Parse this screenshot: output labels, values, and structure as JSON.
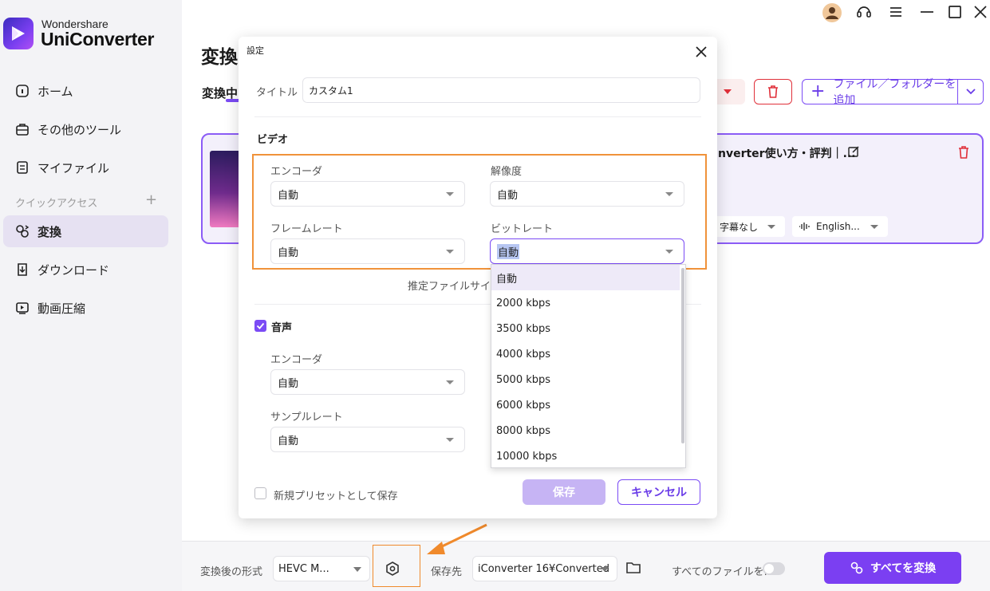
{
  "app": {
    "brand_small": "Wondershare",
    "brand_name": "UniConverter"
  },
  "sidebar": {
    "items": [
      {
        "label": "ホーム",
        "icon": "home-icon"
      },
      {
        "label": "その他のツール",
        "icon": "toolbox-icon"
      },
      {
        "label": "マイファイル",
        "icon": "file-icon"
      }
    ],
    "quick_access_label": "クイックアクセス",
    "quick_items": [
      {
        "label": "変換",
        "icon": "convert-icon",
        "active": true
      },
      {
        "label": "ダウンロード",
        "icon": "download-icon"
      },
      {
        "label": "動画圧縮",
        "icon": "compress-icon"
      }
    ]
  },
  "main": {
    "title": "変換",
    "tab_converting": "変換中",
    "add_files_label": "ファイル／フォルダーを追加",
    "file_name": "nverter使い方・評判｜...",
    "subtitle_select": "字幕なし",
    "audio_select": "English..."
  },
  "dialog": {
    "title": "設定",
    "title_label": "タイトル",
    "title_value": "カスタム1",
    "video_section": "ビデオ",
    "encoder_label": "エンコーダ",
    "encoder_value": "自動",
    "resolution_label": "解像度",
    "resolution_value": "自動",
    "framerate_label": "フレームレート",
    "framerate_value": "自動",
    "bitrate_label": "ビットレート",
    "bitrate_value": "自動",
    "estimated_size_label": "推定ファイルサイズ",
    "audio_section": "音声",
    "audio_enabled": true,
    "audio_encoder_label": "エンコーダ",
    "audio_encoder_value": "自動",
    "sample_rate_label": "サンプルレート",
    "sample_rate_value": "自動",
    "save_preset_label": "新規プリセットとして保存",
    "save_button": "保存",
    "cancel_button": "キャンセル"
  },
  "bitrate_options": [
    "自動",
    "2000 kbps",
    "3500 kbps",
    "4000 kbps",
    "5000 kbps",
    "6000 kbps",
    "8000 kbps",
    "10000 kbps"
  ],
  "bottom_bar": {
    "format_label": "変換後の形式",
    "format_value": "HEVC M...",
    "save_to_label": "保存先",
    "save_to_value": "iConverter 16¥Converted",
    "all_files_label": "すべてのファイルを...",
    "convert_all_button": "すべてを変換"
  },
  "colors": {
    "accent": "#7b3ff2",
    "highlight_box": "#f0923a",
    "danger": "#e0303a"
  }
}
